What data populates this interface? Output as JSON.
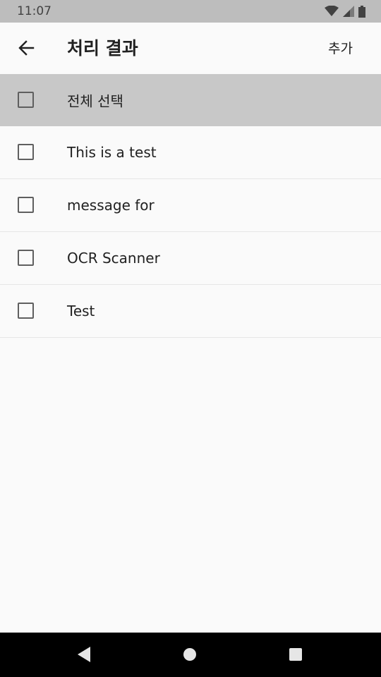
{
  "status_bar": {
    "time": "11:07",
    "icons": [
      "wifi-icon",
      "cell-signal-icon",
      "battery-icon"
    ]
  },
  "app_bar": {
    "back_icon": "arrow-left-icon",
    "title": "처리 결과",
    "action_label": "추가"
  },
  "list": {
    "select_all": {
      "label": "전체 선택",
      "checked": false
    },
    "items": [
      {
        "label": "This is a test",
        "checked": false
      },
      {
        "label": "message for",
        "checked": false
      },
      {
        "label": "OCR Scanner",
        "checked": false
      },
      {
        "label": "Test",
        "checked": false
      }
    ]
  },
  "nav_bar": {
    "buttons": [
      "back-triangle-icon",
      "home-circle-icon",
      "recents-square-icon"
    ]
  },
  "colors": {
    "status_bar": "#bdbdbd",
    "select_all_bg": "#c8c8c8",
    "background": "#fafafa",
    "nav_bar": "#000000"
  }
}
